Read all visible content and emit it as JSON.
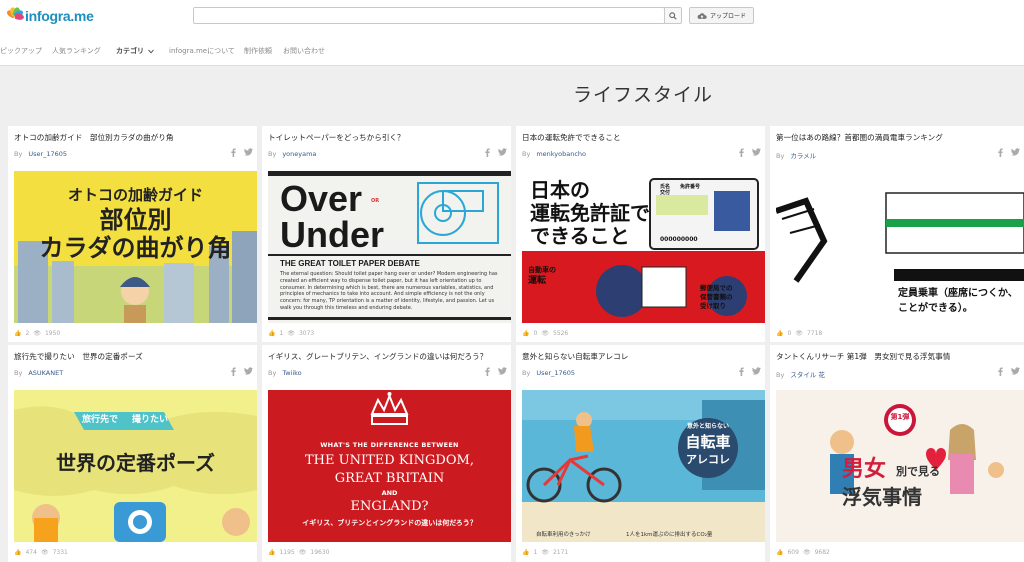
{
  "header": {
    "logo_text": "infogra.me",
    "search": {
      "placeholder": "",
      "value": ""
    },
    "search_icon": "search-icon",
    "upload_label": "アップロード",
    "upload_icon": "cloud-upload-icon"
  },
  "nav": {
    "items": [
      {
        "label": "ピックアップ"
      },
      {
        "label": "人気ランキング"
      },
      {
        "label": "カテゴリ",
        "active": true
      },
      {
        "label": "infogra.meについて"
      },
      {
        "label": "制作依頼"
      },
      {
        "label": "お問い合わせ"
      }
    ]
  },
  "page": {
    "title": "ライフスタイル"
  },
  "cards": [
    {
      "title": "オトコの加齢ガイド　部位別カラダの曲がり角",
      "by": "By",
      "author": "User_17605",
      "likes": "2",
      "views": "1950",
      "thumb_text": [
        "オトコの加齢ガイド",
        "部位別",
        "カラダの曲がり角"
      ]
    },
    {
      "title": "トイレットペーパーをどっちから引く？",
      "by": "By",
      "author": "yoneyama",
      "likes": "1",
      "views": "3073",
      "thumb_text": [
        "Over",
        "OR",
        "Under",
        "THE GREAT TOILET PAPER DEBATE",
        "The eternal question: Should toilet paper hang over or under? Modern engineering has created an efficient way to dispense toilet paper, but it has left orientation up to consumer. In determining which is best, there are numerous variables, statistics, and principles of mechanics to take into account. And simple efficiency is not the only concern: for many, TP orientation is a matter of identity, lifestyle, and passion. Let us walk you through this timeless and enduring debate."
      ]
    },
    {
      "title": "日本の運転免許でできること",
      "by": "By",
      "author": "menkyobancho",
      "likes": "0",
      "views": "5526",
      "thumb_text": [
        "日本の",
        "運転免許証で",
        "できること",
        "自動車の",
        "運転",
        "郵便局での",
        "保管書類の",
        "受け取り",
        "氏名",
        "免許番号",
        "交付",
        "000000000"
      ]
    },
    {
      "title": "第一位はあの路線？首都圏の満員電車ランキング",
      "by": "By",
      "author": "カラメル",
      "likes": "0",
      "views": "7718",
      "thumb_text": [
        "定員乗車（座席につくか、",
        "ことができる）。"
      ]
    },
    {
      "title": "旅行先で撮りたい　世界の定番ポーズ",
      "by": "By",
      "author": "ASUKANET",
      "likes": "474",
      "views": "7331",
      "thumb_text": [
        "旅行先で",
        "撮りたい",
        "世界の定番ポーズ"
      ]
    },
    {
      "title": "イギリス、グレートブリテン、イングランドの違いは何だろう？",
      "by": "By",
      "author": "Twiiko",
      "likes": "1195",
      "views": "19630",
      "thumb_text": [
        "WHAT'S THE DIFFERENCE BETWEEN",
        "THE UNITED KINGDOM,",
        "GREAT BRITAIN",
        "AND",
        "ENGLAND?",
        "イギリス、ブリテンとイングランドの違いは何だろう？"
      ]
    },
    {
      "title": "意外と知らない自転車アレコレ",
      "by": "By",
      "author": "User_17605",
      "likes": "1",
      "views": "2171",
      "thumb_text": [
        "意外と知らない",
        "自転車",
        "アレコレ",
        "自転車利用のきっかけ",
        "1人を1km運ぶのに排出するCO₂量"
      ]
    },
    {
      "title": "タントくんリサーチ 第1弾　男女別で見る浮気事情",
      "by": "By",
      "author": "スタイル 花",
      "likes": "609",
      "views": "9682",
      "thumb_text": [
        "第1弾",
        "男女",
        "別で見る",
        "浮気事情"
      ]
    }
  ],
  "colors": {
    "logo_blue": "#1d8fbf",
    "author_link": "#3a5a8c",
    "card1_bg": "#f3df3f",
    "card3_red": "#d8191f",
    "card6_red": "#cc1b20",
    "card7_bg": "#5ab7d8",
    "card8_bg": "#f7f1ea"
  }
}
